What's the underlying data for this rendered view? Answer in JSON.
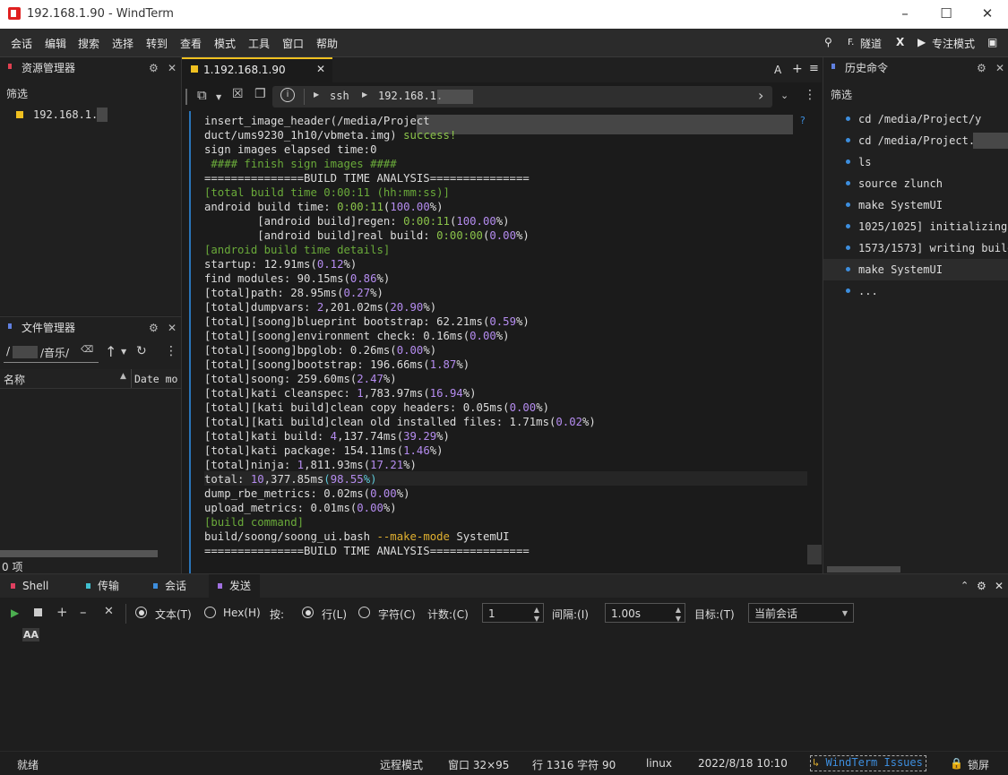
{
  "window": {
    "title": "192.168.1.90 - WindTerm"
  },
  "menu": [
    "会话",
    "编辑",
    "搜索",
    "选择",
    "转到",
    "查看",
    "模式",
    "工具",
    "窗口",
    "帮助"
  ],
  "menu_right": {
    "tunnel": "隧道",
    "focus": "专注模式"
  },
  "resource_panel": {
    "title": "资源管理器",
    "filter": "筛选",
    "host": "192.168.1."
  },
  "file_panel": {
    "title": "文件管理器",
    "path_tail": "/音乐/",
    "col_name": "名称",
    "col_date": "Date mo",
    "count": "0 项"
  },
  "tab": {
    "label": "1.192.168.1.90",
    "right_a": "A"
  },
  "addressbar": {
    "proto": "ssh",
    "host": "192.168.1."
  },
  "terminal": {
    "lines": [
      [
        {
          "t": "insert_image_header(/media/Project"
        }
      ],
      [
        {
          "t": "duct/ums9230_1h10/vbmeta.img) "
        },
        {
          "t": "success!",
          "c": "gs"
        }
      ],
      [
        {
          "t": "sign images elapsed time:0"
        }
      ],
      [
        {
          "t": " #### finish sign images ####",
          "c": "g"
        }
      ],
      [
        {
          "t": "===============BUILD TIME ANALYSIS==============="
        }
      ],
      [
        {
          "t": "[total build time 0:00:11 (hh:mm:ss)]",
          "c": "g"
        }
      ],
      [
        {
          "t": "android build time: "
        },
        {
          "t": "0:00:11",
          "c": "gs"
        },
        {
          "t": "(",
          "c": "w"
        },
        {
          "t": "100.00",
          "c": "p"
        },
        {
          "t": "%)"
        }
      ],
      [
        {
          "t": "        [android build]regen: "
        },
        {
          "t": "0:00:11",
          "c": "gs"
        },
        {
          "t": "("
        },
        {
          "t": "100.00",
          "c": "p"
        },
        {
          "t": "%)"
        }
      ],
      [
        {
          "t": "        [android build]real build: "
        },
        {
          "t": "0:00:00",
          "c": "gs"
        },
        {
          "t": "("
        },
        {
          "t": "0.00",
          "c": "p"
        },
        {
          "t": "%)"
        }
      ],
      [
        {
          "t": "[android build time details]",
          "c": "g"
        }
      ],
      [
        {
          "t": "startup: 12.91ms("
        },
        {
          "t": "0.12",
          "c": "p"
        },
        {
          "t": "%)"
        }
      ],
      [
        {
          "t": "find modules: 90.15ms("
        },
        {
          "t": "0.86",
          "c": "p"
        },
        {
          "t": "%)"
        }
      ],
      [
        {
          "t": "[total]path: 28.95ms("
        },
        {
          "t": "0.27",
          "c": "p"
        },
        {
          "t": "%)"
        }
      ],
      [
        {
          "t": "[total]dumpvars: "
        },
        {
          "t": "2",
          "c": "p"
        },
        {
          "t": ",201.02ms("
        },
        {
          "t": "20.90",
          "c": "p"
        },
        {
          "t": "%)"
        }
      ],
      [
        {
          "t": "[total][soong]blueprint bootstrap: 62.21ms("
        },
        {
          "t": "0.59",
          "c": "p"
        },
        {
          "t": "%)"
        }
      ],
      [
        {
          "t": "[total][soong]environment check: 0.16ms("
        },
        {
          "t": "0.00",
          "c": "p"
        },
        {
          "t": "%)"
        }
      ],
      [
        {
          "t": "[total][soong]bpglob: 0.26ms("
        },
        {
          "t": "0.00",
          "c": "p"
        },
        {
          "t": "%)"
        }
      ],
      [
        {
          "t": "[total][soong]bootstrap: 196.66ms("
        },
        {
          "t": "1.87",
          "c": "p"
        },
        {
          "t": "%)"
        }
      ],
      [
        {
          "t": "[total]soong: 259.60ms("
        },
        {
          "t": "2.47",
          "c": "p"
        },
        {
          "t": "%)"
        }
      ],
      [
        {
          "t": "[total]kati cleanspec: "
        },
        {
          "t": "1",
          "c": "p"
        },
        {
          "t": ",783.97ms("
        },
        {
          "t": "16.94",
          "c": "p"
        },
        {
          "t": "%)"
        }
      ],
      [
        {
          "t": "[total][kati build]clean copy headers: 0.05ms("
        },
        {
          "t": "0.00",
          "c": "p"
        },
        {
          "t": "%)"
        }
      ],
      [
        {
          "t": "[total][kati build]clean old installed files: 1.71ms("
        },
        {
          "t": "0.02",
          "c": "p"
        },
        {
          "t": "%)"
        }
      ],
      [
        {
          "t": "[total]kati build: "
        },
        {
          "t": "4",
          "c": "p"
        },
        {
          "t": ",137.74ms("
        },
        {
          "t": "39.29",
          "c": "p"
        },
        {
          "t": "%)"
        }
      ],
      [
        {
          "t": "[total]kati package: 154.11ms("
        },
        {
          "t": "1.46",
          "c": "p"
        },
        {
          "t": "%)"
        }
      ],
      [
        {
          "t": "[total]ninja: "
        },
        {
          "t": "1",
          "c": "p"
        },
        {
          "t": ",811.93ms("
        },
        {
          "t": "17.21",
          "c": "p"
        },
        {
          "t": "%)"
        }
      ],
      [
        {
          "t": "total: "
        },
        {
          "t": "10",
          "c": "p"
        },
        {
          "t": ",377.85ms"
        },
        {
          "t": "(",
          "c": "cy"
        },
        {
          "t": "98.55",
          "c": "p"
        },
        {
          "t": "%)",
          "c": "cy"
        }
      ],
      [
        {
          "t": "dump_rbe_metrics: 0.02ms("
        },
        {
          "t": "0.00",
          "c": "p"
        },
        {
          "t": "%)"
        }
      ],
      [
        {
          "t": "upload_metrics: 0.01ms("
        },
        {
          "t": "0.00",
          "c": "p"
        },
        {
          "t": "%)"
        }
      ],
      [
        {
          "t": "[build command]",
          "c": "g"
        }
      ],
      [
        {
          "t": "build/soong/soong_ui.bash "
        },
        {
          "t": "--make-mode",
          "c": "y"
        },
        {
          "t": " SystemUI"
        }
      ],
      [
        {
          "t": "===============BUILD TIME ANALYSIS==============="
        }
      ]
    ]
  },
  "history_panel": {
    "title": "历史命令",
    "filter": "筛选",
    "items": [
      "cd /media/Project/y",
      "cd /media/Project.",
      "ls",
      "source zlunch",
      "make SystemUI",
      "1025/1025] initializing",
      "1573/1573] writing build",
      "make SystemUI",
      "..."
    ]
  },
  "bottom_tabs": [
    "Shell",
    "传输",
    "会话",
    "发送"
  ],
  "send_bar": {
    "text": "文本(T)",
    "hex": "Hex(H)",
    "by": "按:",
    "line": "行(L)",
    "char": "字符(C)",
    "count_label": "计数:(C)",
    "count": "1",
    "interval_label": "间隔:(I)",
    "interval": "1.00s",
    "target_label": "目标:(T)",
    "target": "当前会话",
    "aa": "AA"
  },
  "status": {
    "ready": "就绪",
    "mode": "远程模式",
    "window": "窗口 32×95",
    "pos": "行 1316 字符 90",
    "os": "linux",
    "time": "2022/8/18 10:10",
    "issues": "WindTerm Issues",
    "lock": "锁屏"
  }
}
